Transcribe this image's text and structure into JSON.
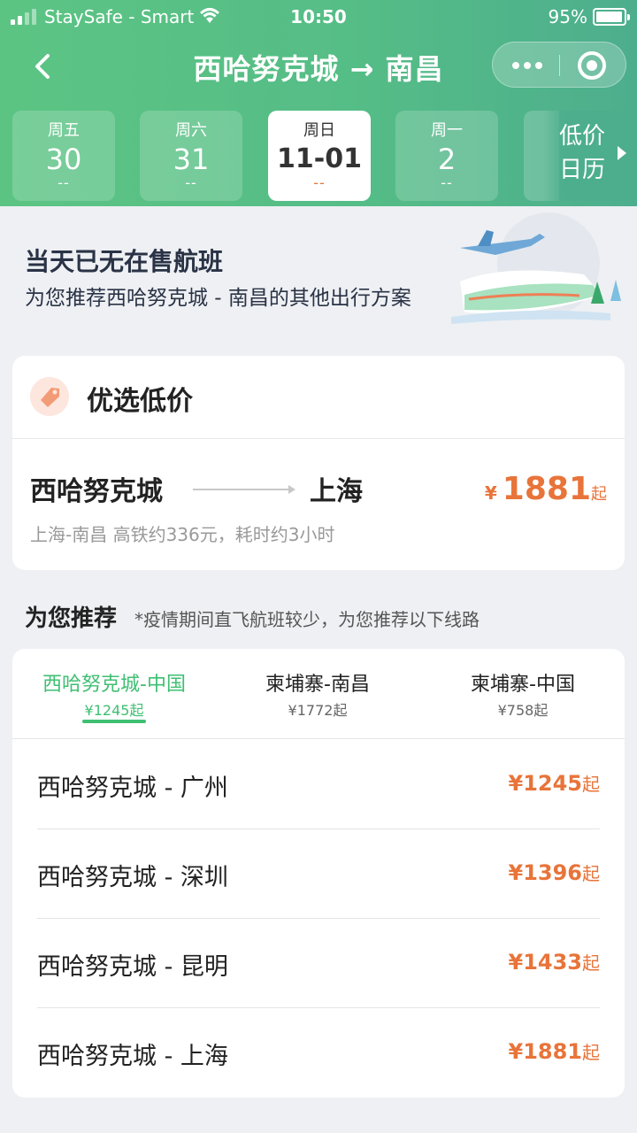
{
  "status_bar": {
    "carrier": "StaySafe - Smart",
    "time": "10:50",
    "battery": "95%"
  },
  "nav": {
    "title": "西哈努克城 → 南昌"
  },
  "dates": [
    {
      "weekday": "周五",
      "day": "30",
      "price": "--"
    },
    {
      "weekday": "周六",
      "day": "31",
      "price": "--"
    },
    {
      "weekday": "周日",
      "day": "11-01",
      "price": "--",
      "selected": true
    },
    {
      "weekday": "周一",
      "day": "2",
      "price": "--"
    }
  ],
  "calendar_button": {
    "line1": "低价",
    "line2": "日历"
  },
  "notice": {
    "title": "当天已无在售航班",
    "subtitle": "为您推荐西哈努克城 - 南昌的其他出行方案"
  },
  "best_price": {
    "heading": "优选低价",
    "from": "西哈努克城",
    "to": "上海",
    "currency": "¥",
    "price": "1881",
    "suffix": "起",
    "description": "上海-南昌 高铁约336元，耗时约3小时"
  },
  "recommend": {
    "title": "为您推荐",
    "note": "*疫情期间直飞航班较少，为您推荐以下线路",
    "tabs": [
      {
        "label": "西哈努克城-中国",
        "price": "¥1245起",
        "active": true
      },
      {
        "label": "柬埔寨-南昌",
        "price": "¥1772起"
      },
      {
        "label": "柬埔寨-中国",
        "price": "¥758起"
      }
    ],
    "routes": [
      {
        "name": "西哈努克城 - 广州",
        "price": "¥1245",
        "suffix": "起"
      },
      {
        "name": "西哈努克城 - 深圳",
        "price": "¥1396",
        "suffix": "起"
      },
      {
        "name": "西哈努克城 - 昆明",
        "price": "¥1433",
        "suffix": "起"
      },
      {
        "name": "西哈努克城 - 上海",
        "price": "¥1881",
        "suffix": "起"
      }
    ]
  },
  "colors": {
    "header_green": "#55bd86",
    "accent_green": "#3fbf72",
    "price_orange": "#e8743a"
  }
}
